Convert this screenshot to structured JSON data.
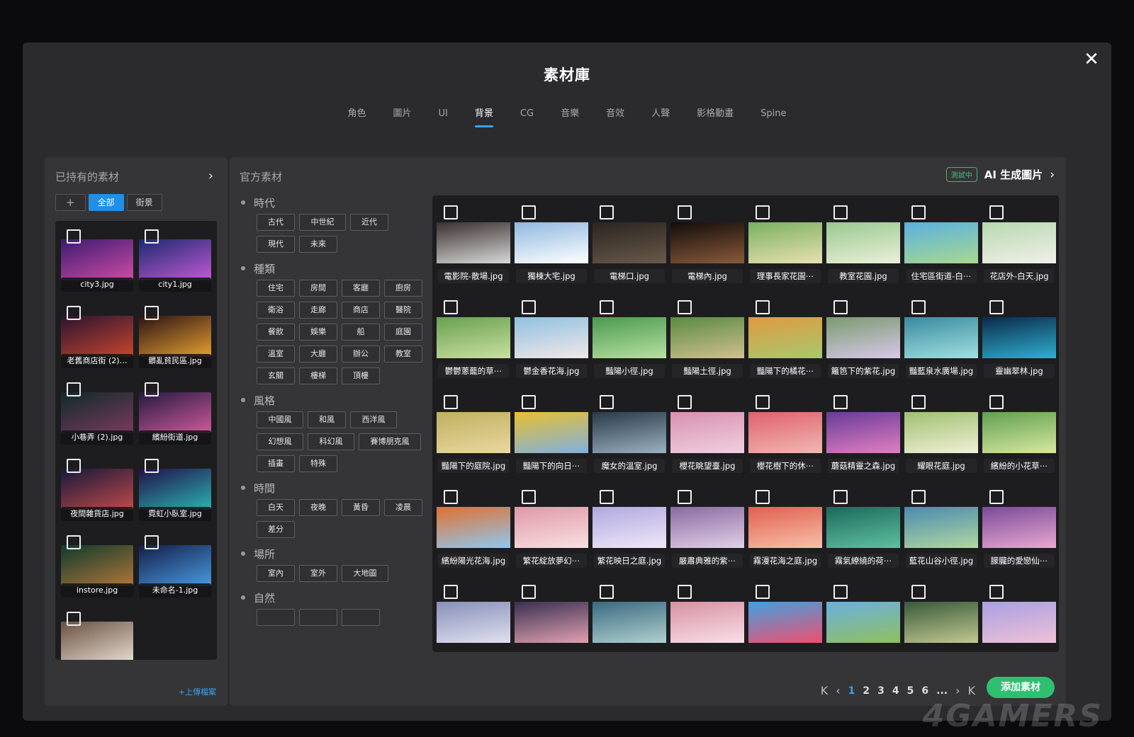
{
  "modal": {
    "title": "素材庫",
    "close": "✕"
  },
  "tabs": [
    "角色",
    "圖片",
    "UI",
    "背景",
    "CG",
    "音樂",
    "音效",
    "人聲",
    "影格動畫",
    "Spine"
  ],
  "active_tab": 3,
  "owned": {
    "title": "已持有的素材",
    "arrow": "›",
    "filters": {
      "add": "+",
      "all": "全部",
      "street": "街景"
    },
    "upload": "+上傳檔案",
    "items": [
      {
        "label": "city3.jpg",
        "c1": "#3a1c6e",
        "c2": "#d04ba8"
      },
      {
        "label": "city1.jpg",
        "c1": "#1c2a6e",
        "c2": "#c25ad6"
      },
      {
        "label": "老舊商店街 (2)…",
        "c1": "#2a1430",
        "c2": "#c8452e"
      },
      {
        "label": "髒亂貧民區.jpg",
        "c1": "#2b1216",
        "c2": "#e6a030"
      },
      {
        "label": "小巷弄 (2).jpg",
        "c1": "#102a2a",
        "c2": "#7a3a5e"
      },
      {
        "label": "繽紛街道.jpg",
        "c1": "#241a40",
        "c2": "#d05a9a"
      },
      {
        "label": "夜間雜貨店.jpg",
        "c1": "#16183a",
        "c2": "#c04a4a"
      },
      {
        "label": "霓虹小臥室.jpg",
        "c1": "#22104a",
        "c2": "#2bb3b0"
      },
      {
        "label": "instore.jpg",
        "c1": "#0f3a2c",
        "c2": "#b0763a"
      },
      {
        "label": "未命名-1.jpg",
        "c1": "#141e4a",
        "c2": "#4a9ae0"
      },
      {
        "label": "",
        "c1": "#6a5040",
        "c2": "#e6ddd2"
      }
    ]
  },
  "official": {
    "title": "官方素材",
    "ai_badge": "測試中",
    "ai_label": "AI 生成圖片",
    "ai_arrow": "›",
    "filter_groups": [
      {
        "name": "時代",
        "chips": [
          "古代",
          "中世紀",
          "近代",
          "現代",
          "未來"
        ]
      },
      {
        "name": "種類",
        "chips": [
          "住宅",
          "房間",
          "客廳",
          "廚房",
          "衛浴",
          "走廊",
          "商店",
          "醫院",
          "餐飲",
          "娛樂",
          "船",
          "庭園",
          "溫室",
          "大廳",
          "辦公",
          "教室",
          "玄關",
          "樓梯",
          "頂樓"
        ]
      },
      {
        "name": "風格",
        "chips": [
          "中國風",
          "和風",
          "西洋風",
          "幻想風",
          "科幻風",
          "賽博朋克風",
          "插畫",
          "特殊"
        ]
      },
      {
        "name": "時間",
        "chips": [
          "白天",
          "夜晚",
          "黃昏",
          "凌晨",
          "差分"
        ]
      },
      {
        "name": "場所",
        "chips": [
          "室內",
          "室外",
          "大地圖"
        ]
      },
      {
        "name": "自然",
        "chips": [
          "",
          "",
          ""
        ]
      }
    ],
    "items": [
      {
        "label": "電影院-散場.jpg",
        "c1": "#3a3030",
        "c2": "#d8d8d8"
      },
      {
        "label": "獨棟大宅.jpg",
        "c1": "#8fb8e0",
        "c2": "#ffffff"
      },
      {
        "label": "電梯口.jpg",
        "c1": "#2a2420",
        "c2": "#6a5a4a"
      },
      {
        "label": "電梯內.jpg",
        "c1": "#120c0a",
        "c2": "#8a5a3a"
      },
      {
        "label": "理事長家花園⋯",
        "c1": "#7ab060",
        "c2": "#e8e0b0"
      },
      {
        "label": "教室花園.jpg",
        "c1": "#9ac890",
        "c2": "#eaf0d8"
      },
      {
        "label": "住宅區街道-白⋯",
        "c1": "#5ab0e0",
        "c2": "#a8d890"
      },
      {
        "label": "花店外-白天.jpg",
        "c1": "#b8d8b0",
        "c2": "#f0f0e8"
      },
      {
        "label": "鬱鬱蔥蘢的草⋯",
        "c1": "#6aa050",
        "c2": "#c8e0a0"
      },
      {
        "label": "鬱金香花海.jpg",
        "c1": "#90c0e0",
        "c2": "#f0e8e8"
      },
      {
        "label": "豔陽小徑.jpg",
        "c1": "#4a9a50",
        "c2": "#b8e0a0"
      },
      {
        "label": "豔陽土徑.jpg",
        "c1": "#5a8a40",
        "c2": "#d0c090"
      },
      {
        "label": "豔陽下的橘花⋯",
        "c1": "#e09a40",
        "c2": "#a8c870"
      },
      {
        "label": "籬笆下的紫花.jpg",
        "c1": "#7a9a70",
        "c2": "#d8c8e8"
      },
      {
        "label": "豔藍泉水廣場.jpg",
        "c1": "#3a8aa0",
        "c2": "#a0e0e0"
      },
      {
        "label": "靈幽翠林.jpg",
        "c1": "#0a2a4a",
        "c2": "#30b0d0"
      },
      {
        "label": "豔陽下的庭院.jpg",
        "c1": "#c0b060",
        "c2": "#e8d8a0"
      },
      {
        "label": "豔陽下的向日⋯",
        "c1": "#e8c030",
        "c2": "#80b0e0"
      },
      {
        "label": "魔女的溫室.jpg",
        "c1": "#2a3a4a",
        "c2": "#9ab0c0"
      },
      {
        "label": "櫻花眺望臺.jpg",
        "c1": "#d890b0",
        "c2": "#f0d0e0"
      },
      {
        "label": "櫻花樹下的休⋯",
        "c1": "#e06070",
        "c2": "#f0b8b0"
      },
      {
        "label": "蘑菇精靈之森.jpg",
        "c1": "#6a3a9a",
        "c2": "#e080c0"
      },
      {
        "label": "耀眼花庭.jpg",
        "c1": "#a0c070",
        "c2": "#f0f0d8"
      },
      {
        "label": "繽紛的小花草⋯",
        "c1": "#60a050",
        "c2": "#d8e8a0"
      },
      {
        "label": "繽紛陽光花海.jpg",
        "c1": "#e07030",
        "c2": "#90c8f0"
      },
      {
        "label": "繁花綻放夢幻⋯",
        "c1": "#e098a8",
        "c2": "#f8e0e0"
      },
      {
        "label": "繁花映日之庭.jpg",
        "c1": "#b0a8e0",
        "c2": "#f0e8f8"
      },
      {
        "label": "嚴肅典雅的紫⋯",
        "c1": "#8a6aa0",
        "c2": "#e0d0e8"
      },
      {
        "label": "霧漫花海之庭.jpg",
        "c1": "#e06050",
        "c2": "#f8c0a8"
      },
      {
        "label": "霧氣繚繞的荷⋯",
        "c1": "#1a6a5a",
        "c2": "#60c0a0"
      },
      {
        "label": "藍花山谷小徑.jpg",
        "c1": "#4a8ab0",
        "c2": "#b0d8a0"
      },
      {
        "label": "朦朧的愛戀仙⋯",
        "c1": "#7a4a9a",
        "c2": "#e8a8d0"
      },
      {
        "label": "",
        "c1": "#8890b8",
        "c2": "#e0e0f0"
      },
      {
        "label": "",
        "c1": "#3a3050",
        "c2": "#e0a0b0"
      },
      {
        "label": "",
        "c1": "#3a6a80",
        "c2": "#b0d0d0"
      },
      {
        "label": "",
        "c1": "#d890a0",
        "c2": "#f8e0e8"
      },
      {
        "label": "",
        "c1": "#40a0e0",
        "c2": "#f05070"
      },
      {
        "label": "",
        "c1": "#6ab0e0",
        "c2": "#90c060"
      },
      {
        "label": "",
        "c1": "#3a5a3a",
        "c2": "#c0c890"
      },
      {
        "label": "",
        "c1": "#a8a0e0",
        "c2": "#f0c0d8"
      }
    ],
    "pagination": {
      "first": "K",
      "prev": "‹",
      "pages": [
        "1",
        "2",
        "3",
        "4",
        "5",
        "6"
      ],
      "current": "1",
      "ellipsis": "...",
      "next": "›",
      "last": "K"
    },
    "add_button": "添加素材"
  },
  "watermark": "4GAMERS"
}
